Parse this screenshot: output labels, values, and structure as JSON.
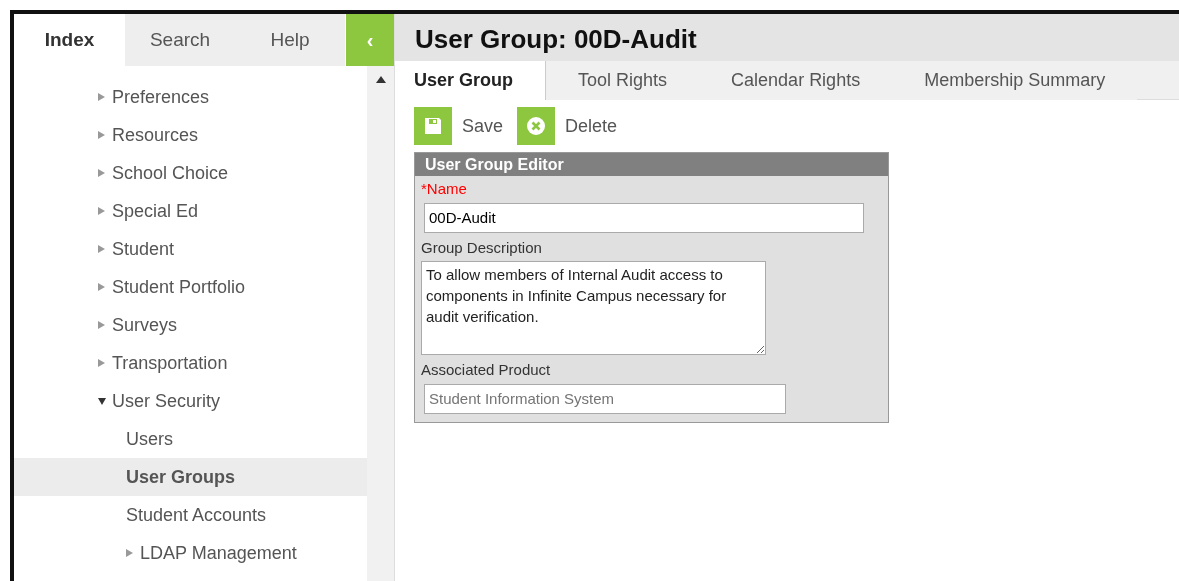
{
  "sidebar": {
    "tabs": [
      {
        "label": "Index",
        "selected": true
      },
      {
        "label": "Search",
        "selected": false
      },
      {
        "label": "Help",
        "selected": false
      }
    ],
    "collapse_button": {
      "label": "‹"
    },
    "tree": [
      {
        "label": "Preferences",
        "kind": "folder",
        "expanded": false,
        "selected": false
      },
      {
        "label": "Resources",
        "kind": "folder",
        "expanded": false,
        "selected": false
      },
      {
        "label": "School Choice",
        "kind": "folder",
        "expanded": false,
        "selected": false
      },
      {
        "label": "Special Ed",
        "kind": "folder",
        "expanded": false,
        "selected": false
      },
      {
        "label": "Student",
        "kind": "folder",
        "expanded": false,
        "selected": false
      },
      {
        "label": "Student Portfolio",
        "kind": "folder",
        "expanded": false,
        "selected": false
      },
      {
        "label": "Surveys",
        "kind": "folder",
        "expanded": false,
        "selected": false
      },
      {
        "label": "Transportation",
        "kind": "folder",
        "expanded": false,
        "selected": false
      },
      {
        "label": "User Security",
        "kind": "folder",
        "expanded": true,
        "selected": false,
        "children": [
          {
            "label": "Users",
            "kind": "leaf",
            "selected": false
          },
          {
            "label": "User Groups",
            "kind": "leaf",
            "selected": true
          },
          {
            "label": "Student Accounts",
            "kind": "leaf",
            "selected": false
          },
          {
            "label": "LDAP Management",
            "kind": "folder",
            "expanded": false,
            "selected": false
          }
        ]
      }
    ]
  },
  "main": {
    "title": "User Group: 00D-Audit",
    "tabs": [
      {
        "label": "User Group",
        "selected": true
      },
      {
        "label": "Tool Rights",
        "selected": false
      },
      {
        "label": "Calendar Rights",
        "selected": false
      },
      {
        "label": "Membership Summary",
        "selected": false
      }
    ],
    "toolbar": [
      {
        "label": "Save",
        "kind": "save"
      },
      {
        "label": "Delete",
        "kind": "delete"
      }
    ],
    "editor": {
      "title": "User Group Editor",
      "name_label": "*Name",
      "name_value": "00D-Audit",
      "description_label": "Group Description",
      "description_value": "To allow members of Internal Audit access to components in Infinite Campus necessary for audit verification.",
      "product_label": "Associated Product",
      "product_placeholder": "Student Information System"
    }
  }
}
